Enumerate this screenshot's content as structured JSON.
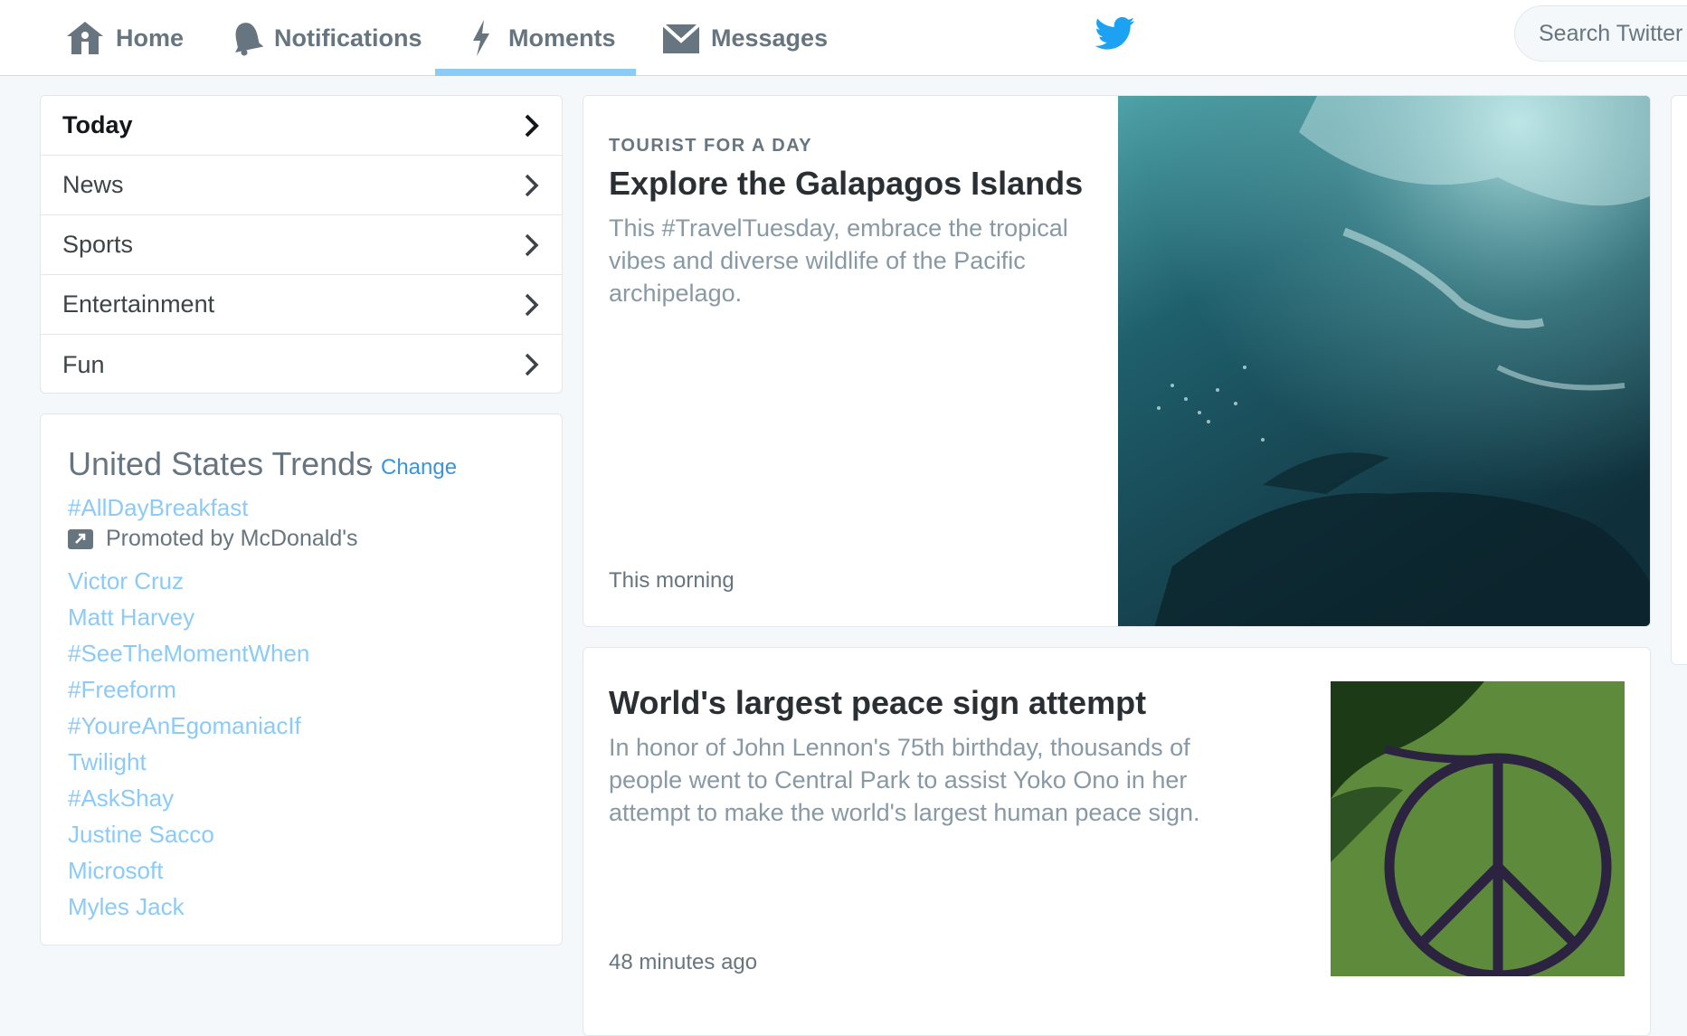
{
  "nav": {
    "items": [
      {
        "label": "Home",
        "icon": "home-icon"
      },
      {
        "label": "Notifications",
        "icon": "bell-icon"
      },
      {
        "label": "Moments",
        "icon": "lightning-icon",
        "active": true
      },
      {
        "label": "Messages",
        "icon": "envelope-icon"
      }
    ],
    "logo": "twitter-bird-icon",
    "search_placeholder": "Search Twitter"
  },
  "categories": [
    {
      "label": "Today",
      "selected": true
    },
    {
      "label": "News"
    },
    {
      "label": "Sports"
    },
    {
      "label": "Entertainment"
    },
    {
      "label": "Fun"
    }
  ],
  "trends": {
    "title": "United States Trends",
    "separator": "·",
    "change_label": "Change",
    "promoted_trend": "#AllDayBreakfast",
    "promoted_by": "Promoted by McDonald's",
    "items": [
      "Victor Cruz",
      "Matt Harvey",
      "#SeeTheMomentWhen",
      "#Freeform",
      "#YoureAnEgomaniacIf",
      "Twilight",
      "#AskShay",
      "Justine Sacco",
      "Microsoft",
      "Myles Jack"
    ]
  },
  "moments": [
    {
      "kicker": "TOURIST FOR A DAY",
      "title": "Explore the Galapagos Islands",
      "description_lines": [
        "This #TravelTuesday, embrace the tropical",
        "vibes and diverse wildlife of the Pacific",
        "archipelago."
      ],
      "time": "This morning"
    },
    {
      "kicker": "",
      "title": "World's largest peace sign attempt",
      "description_lines": [
        "In honor of John Lennon's 75th birthday, thousands of",
        "people went to Central Park to assist Yoko Ono in her",
        "attempt to make the world's largest human peace sign."
      ],
      "time": "48 minutes ago"
    }
  ],
  "colors": {
    "accent": "#1da1f2",
    "link": "#8ccaf7",
    "muted": "#66757f",
    "underline": "#8ccaf7"
  }
}
